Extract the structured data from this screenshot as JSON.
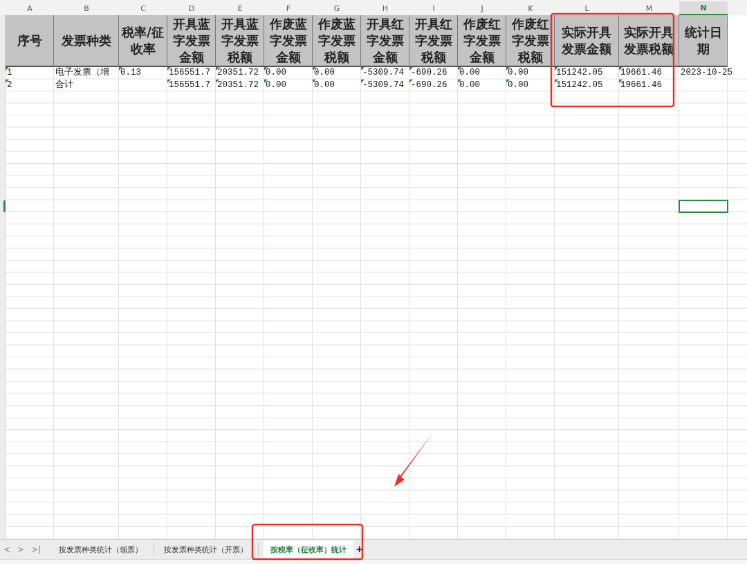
{
  "columns": [
    {
      "letter": "A",
      "selected": false
    },
    {
      "letter": "B",
      "selected": false
    },
    {
      "letter": "C",
      "selected": false
    },
    {
      "letter": "D",
      "selected": false
    },
    {
      "letter": "E",
      "selected": false
    },
    {
      "letter": "F",
      "selected": false
    },
    {
      "letter": "G",
      "selected": false
    },
    {
      "letter": "H",
      "selected": false
    },
    {
      "letter": "I",
      "selected": false
    },
    {
      "letter": "J",
      "selected": false
    },
    {
      "letter": "K",
      "selected": false
    },
    {
      "letter": "L",
      "selected": false
    },
    {
      "letter": "M",
      "selected": false
    },
    {
      "letter": "N",
      "selected": true
    }
  ],
  "headers": [
    "序号",
    "发票种类",
    "税率/征收率",
    "开具蓝字发票金额",
    "开具蓝字发票税额",
    "作废蓝字发票金额",
    "作废蓝字发票税额",
    "开具红字发票金额",
    "开具红字发票税额",
    "作废红字发票金额",
    "作废红字发票税额",
    "实际开具发票金额",
    "实际开具发票税额",
    "统计日期"
  ],
  "rows": [
    {
      "cells": [
        {
          "text": "1",
          "flagged": true
        },
        {
          "text": "电子发票（增"
        },
        {
          "text": "0.13",
          "flagged": true
        },
        {
          "text": "156551.7",
          "flagged": true
        },
        {
          "text": "20351.72",
          "flagged": true
        },
        {
          "text": "0.00",
          "flagged": true
        },
        {
          "text": "0.00",
          "flagged": true
        },
        {
          "text": "-5309.74",
          "flagged": true
        },
        {
          "text": "-690.26",
          "flagged": true
        },
        {
          "text": "0.00",
          "flagged": true
        },
        {
          "text": "0.00",
          "flagged": true
        },
        {
          "text": "151242.05",
          "flagged": true
        },
        {
          "text": "19661.46",
          "flagged": true
        },
        {
          "text": "2023-10-25"
        }
      ]
    },
    {
      "cells": [
        {
          "text": "2",
          "flagged": true
        },
        {
          "text": "合计"
        },
        {},
        {
          "text": "156551.7",
          "flagged": true
        },
        {
          "text": "20351.72",
          "flagged": true
        },
        {
          "text": "0.00",
          "flagged": true
        },
        {
          "text": "0.00",
          "flagged": true
        },
        {
          "text": "-5309.74",
          "flagged": true
        },
        {
          "text": "-690.26",
          "flagged": true
        },
        {
          "text": "0.00",
          "flagged": true
        },
        {
          "text": "0.00",
          "flagged": true
        },
        {
          "text": "151242.05",
          "flagged": true
        },
        {
          "text": "19661.46",
          "flagged": true
        },
        {}
      ]
    }
  ],
  "sheet_nav": [
    "<",
    ">",
    ">|"
  ],
  "sheet_tabs": [
    {
      "label": "按发票种类统计（领票）",
      "selected": false
    },
    {
      "label": "按发票种类统计（开票）",
      "selected": false
    },
    {
      "label": "按税率（征收率）统计",
      "selected": true
    }
  ],
  "add_sheet": "+"
}
